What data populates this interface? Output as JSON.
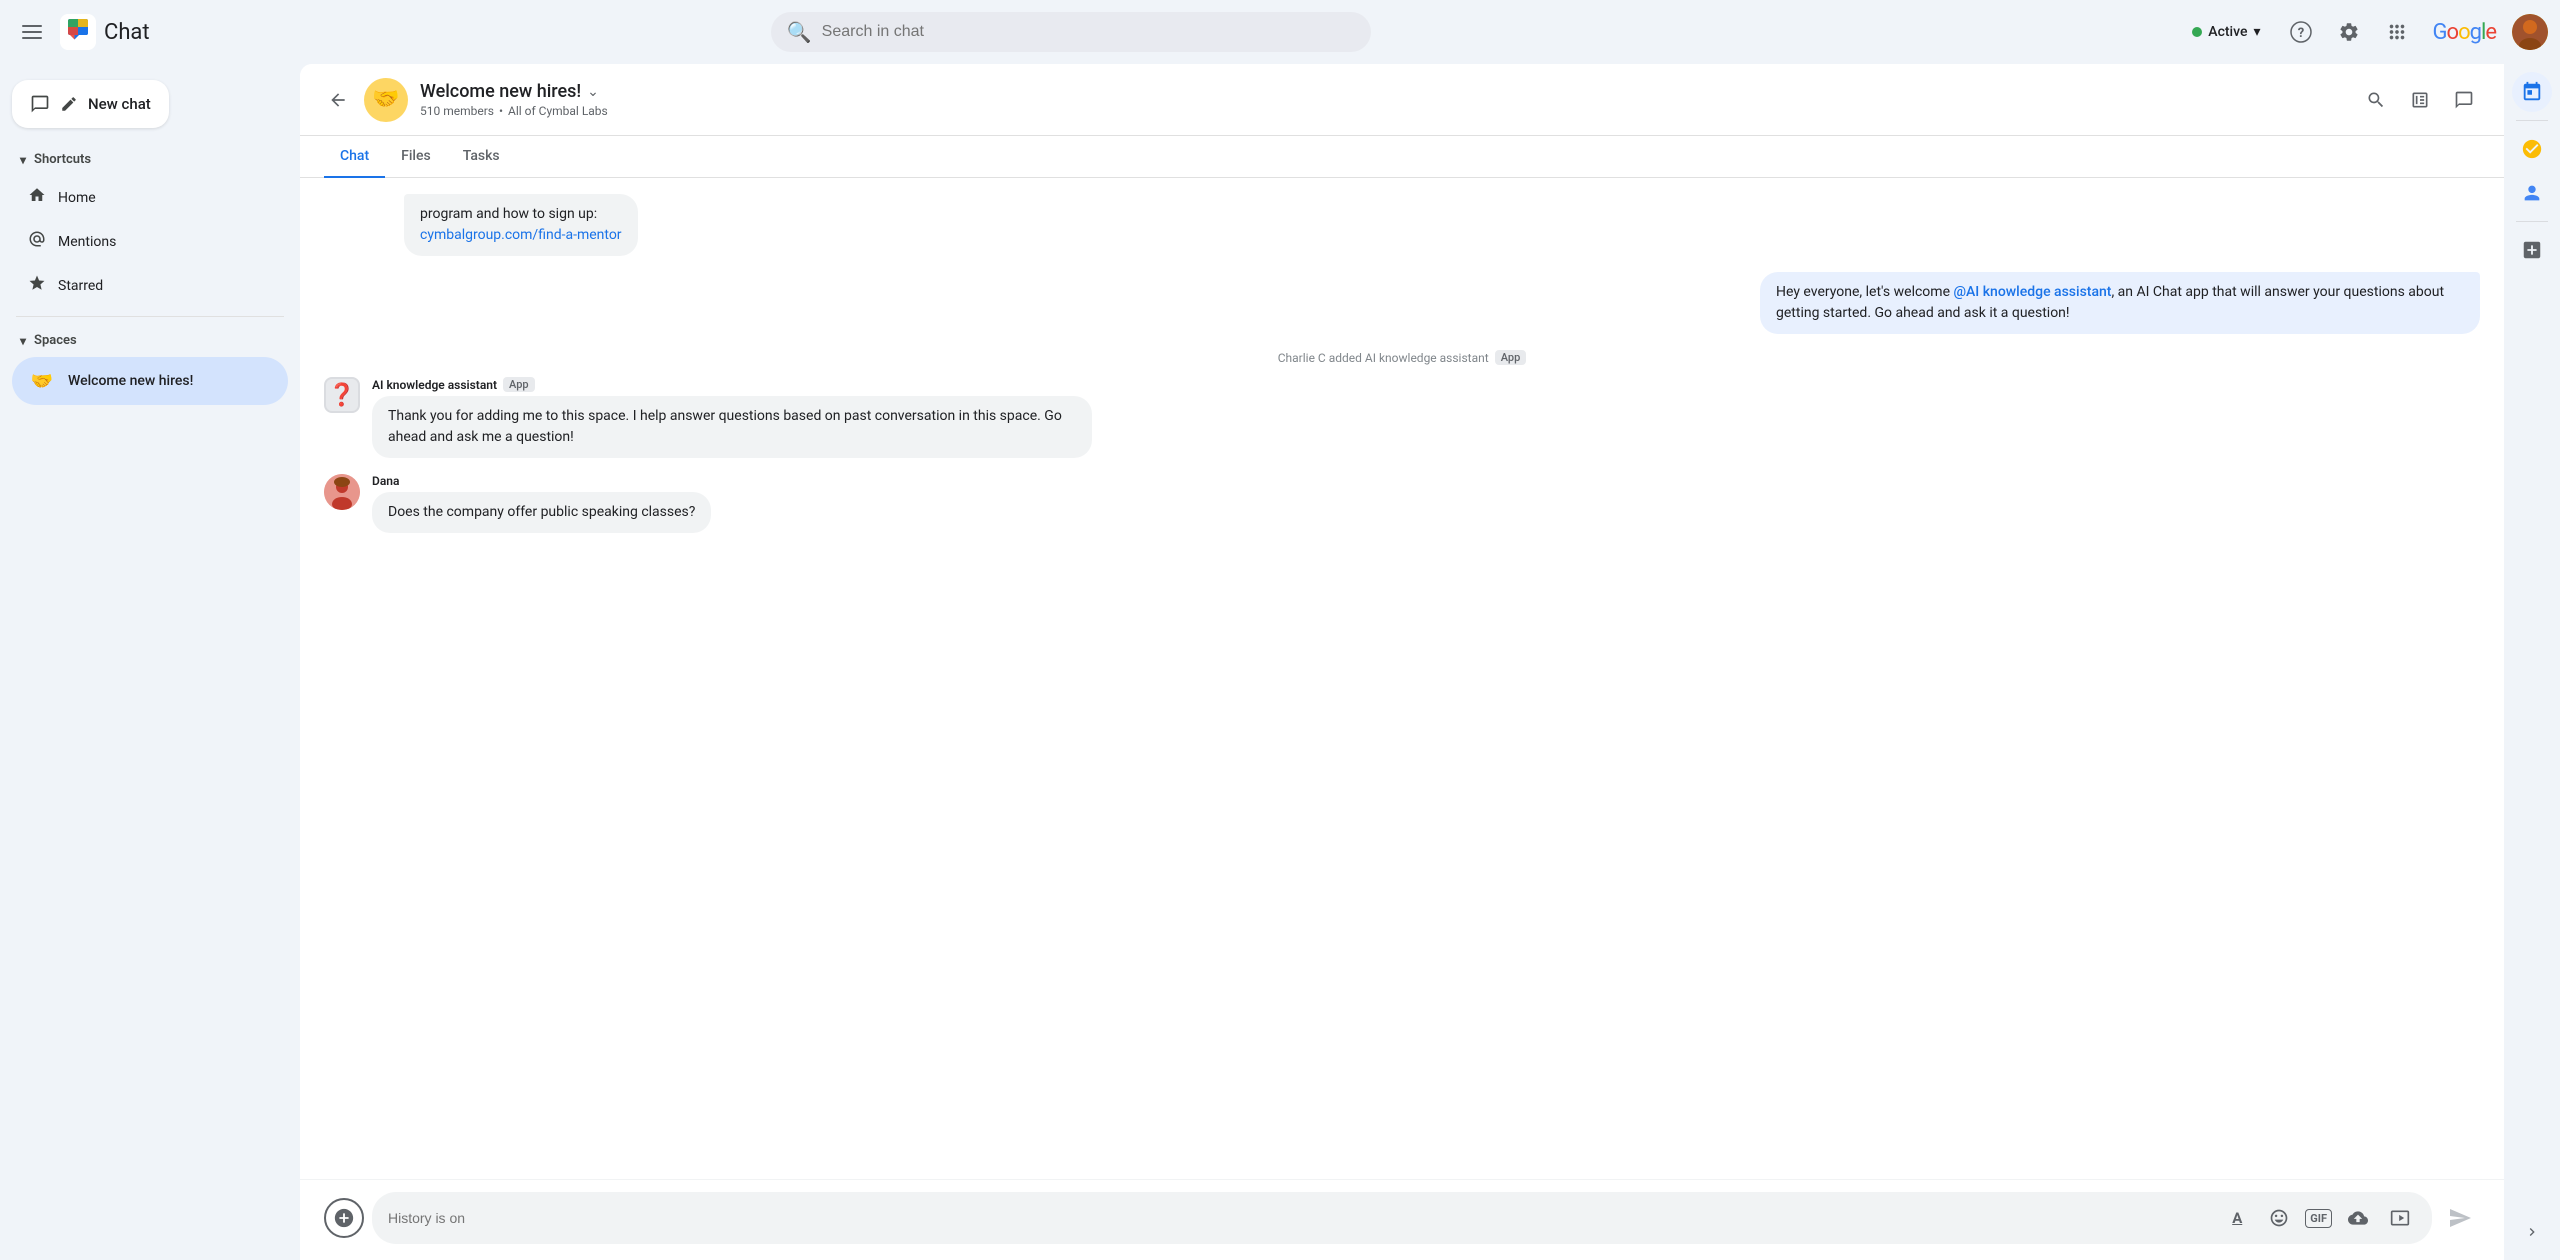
{
  "topBar": {
    "hamburger": "☰",
    "appTitle": "Chat",
    "searchPlaceholder": "Search in chat",
    "statusLabel": "Active",
    "statusColor": "#34a853",
    "chevron": "▾",
    "helpIcon": "?",
    "settingsIcon": "⚙",
    "appsIcon": "⋮⋮⋮",
    "googleText": "Google",
    "avatarEmoji": "🧑"
  },
  "sidebar": {
    "newChatLabel": "New chat",
    "shortcutsLabel": "Shortcuts",
    "homeLabel": "Home",
    "mentionsLabel": "Mentions",
    "starredLabel": "Starred",
    "spacesLabel": "Spaces",
    "activeSpaceName": "Welcome new hires!",
    "activeSpaceEmoji": "🤝"
  },
  "chatHeader": {
    "spaceName": "Welcome new hires!",
    "spaceEmoji": "🤝",
    "chevron": "⌄",
    "membersCount": "510 members",
    "orgLabel": "All of Cymbal Labs"
  },
  "tabs": [
    {
      "label": "Chat",
      "active": true
    },
    {
      "label": "Files",
      "active": false
    },
    {
      "label": "Tasks",
      "active": false
    }
  ],
  "messages": [
    {
      "type": "partial",
      "text": "program and how to sign up:",
      "link": "cymbalgroup.com/find-a-mentor",
      "align": "left"
    },
    {
      "type": "user",
      "text": "Hey everyone, let's welcome @AI knowledge assistant, an AI Chat app that will answer your questions about getting started.  Go ahead and ask it a question!",
      "mentionText": "@AI knowledge assistant",
      "align": "right"
    },
    {
      "type": "system",
      "text": "Charlie C added AI knowledge assistant",
      "badge": "App"
    },
    {
      "type": "bot",
      "sender": "AI knowledge assistant",
      "badge": "App",
      "text": "Thank you for adding me to this space. I help answer questions based on past conversation in this space. Go ahead and ask me a question!",
      "avatarIcon": "❓"
    },
    {
      "type": "user-left",
      "sender": "Dana",
      "text": "Does the company offer public speaking classes?",
      "avatarEmoji": "👩"
    }
  ],
  "inputArea": {
    "placeholder": "History is on",
    "addIcon": "+",
    "formatIcon": "A̲",
    "emojiIcon": "☺",
    "gifIcon": "GIF",
    "uploadIcon": "⬆",
    "videoIcon": "⬛",
    "sendIcon": "▶"
  },
  "rightSidebar": {
    "calendarIcon": "📅",
    "tasksIcon": "✔",
    "contactsIcon": "👤",
    "addIcon": "+",
    "collapseIcon": "›"
  }
}
